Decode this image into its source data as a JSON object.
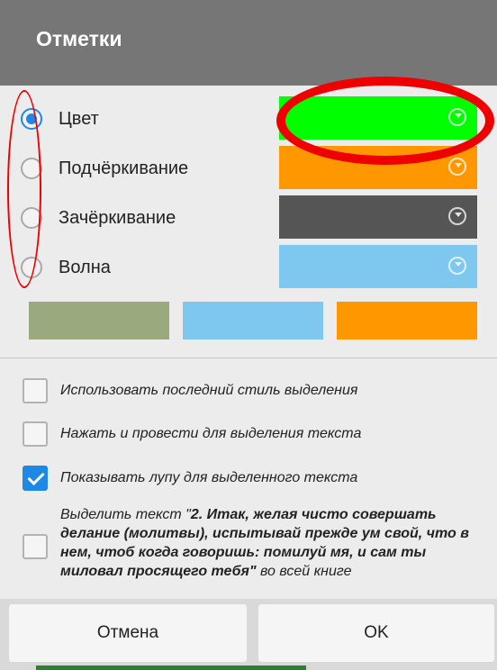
{
  "dialog": {
    "title": "Отметки"
  },
  "styles": [
    {
      "label": "Цвет",
      "checked": true,
      "color": "#00ff00"
    },
    {
      "label": "Подчёркивание",
      "checked": false,
      "color": "#ff9800"
    },
    {
      "label": "Зачёркивание",
      "checked": false,
      "color": "#555555"
    },
    {
      "label": "Волна",
      "checked": false,
      "color": "#7ec8ef"
    }
  ],
  "presets": [
    "#9aa97e",
    "#7ec8ef",
    "#ff9800"
  ],
  "options": [
    {
      "label": "Использовать последний стиль выделения",
      "checked": false
    },
    {
      "label": "Нажать и провести для выделения текста",
      "checked": false
    },
    {
      "label": "Показывать лупу для выделенного текста",
      "checked": true
    }
  ],
  "highlight_all": {
    "prefix": "Выделить текст \"",
    "quote": "2. Итак, желая чисто совершать делание (молитвы), испытывай прежде ум свой, что в нем, чтоб когда говоришь: помилуй мя, и сам ты миловал просящего тебя\"",
    "suffix": " во всей книге",
    "checked": false
  },
  "buttons": {
    "cancel": "Отмена",
    "ok": "OK"
  },
  "annotation_color": "#ee0000"
}
